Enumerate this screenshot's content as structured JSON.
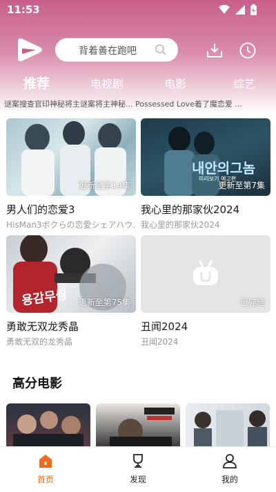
{
  "status_bar": {
    "time": "11:53"
  },
  "search": {
    "placeholder": "背着善在跑吧"
  },
  "tabs": [
    {
      "label": "推荐",
      "active": true
    },
    {
      "label": "电视剧",
      "active": false
    },
    {
      "label": "电影",
      "active": false
    },
    {
      "label": "综艺",
      "active": false
    }
  ],
  "ticker_text": "谜案搜查官印神秘将主谜案将主神秘... Possessed Love着了魔恋爱 ...",
  "cards": [
    {
      "title": "男人们的恋爱3",
      "subtitle": "HisMan3ボクらの恋愛シェアハウ...",
      "badge": "更新至第14集"
    },
    {
      "title": "我心里的那家伙2024",
      "subtitle": "我心里的那家伙2024",
      "badge": "更新至第7集",
      "overlay_text": "내안의그놈",
      "overlay_sub": "미리보기 예고편"
    },
    {
      "title": "勇敢无双龙秀晶",
      "subtitle": "勇敢无双的龙秀晶",
      "badge": "更新至第75集",
      "overlay_text": "용감무쌍"
    },
    {
      "title": "丑闻2024",
      "subtitle": "丑闻2024",
      "badge": "已完结"
    }
  ],
  "section": {
    "title": "高分电影"
  },
  "bottom_nav": [
    {
      "label": "首页",
      "icon": "home-icon",
      "active": true
    },
    {
      "label": "发现",
      "icon": "trophy-icon",
      "active": false
    },
    {
      "label": "我的",
      "icon": "user-icon",
      "active": false
    }
  ],
  "colors": {
    "accent": "#f26a1b",
    "header": "#c85f8a",
    "placeholder_logo": "#ffffff"
  }
}
